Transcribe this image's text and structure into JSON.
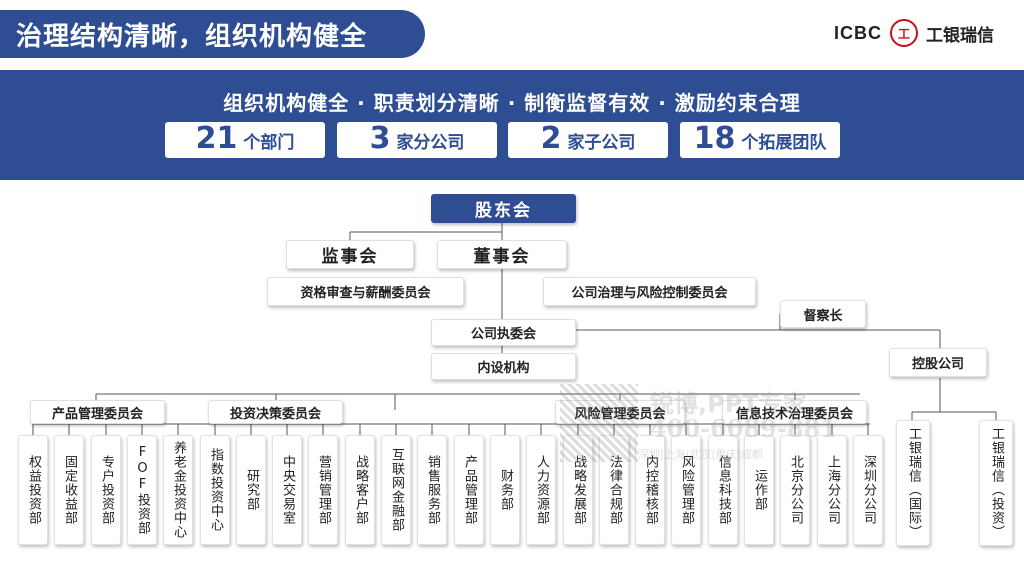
{
  "header": {
    "title": "治理结构清晰，组织机构健全",
    "logo_en": "ICBC",
    "logo_mark": "工",
    "logo_cn": "工银瑞信"
  },
  "banner": {
    "slogan": "组织机构健全 · 职责划分清晰 · 制衡监督有效 · 激励约束合理",
    "stats": [
      {
        "number": "21",
        "unit": "个部门"
      },
      {
        "number": "3",
        "unit": "家分公司"
      },
      {
        "number": "2",
        "unit": "家子公司"
      },
      {
        "number": "18",
        "unit": "个拓展团队"
      }
    ]
  },
  "org": {
    "shareholders": "股东会",
    "supervisors": "监事会",
    "board": "董事会",
    "committee_left": "资格审查与薪酬委员会",
    "committee_right": "公司治理与风险控制委员会",
    "inspector": "督察长",
    "executive": "公司执委会",
    "internal": "内设机构",
    "holding": "控股公司",
    "groups": [
      "产品管理委员会",
      "投资决策委员会",
      "风险管理委员会",
      "信息技术治理委员会"
    ],
    "departments": [
      "权益投资部",
      "固定收益部",
      "专户投资部",
      "FOF投资部",
      "养老金投资中心",
      "指数投资中心",
      "研究部",
      "中央交易室",
      "营销管理部",
      "战略客户部",
      "互联网金融部",
      "销售服务部",
      "产品管理部",
      "财务部",
      "人力资源部",
      "战略发展部",
      "法律合规部",
      "内控稽核部",
      "风险管理部",
      "信息科技部",
      "运作部",
      "北京分公司",
      "上海分公司",
      "深圳分公司"
    ],
    "subsidiaries": [
      "工银瑞信（国际）",
      "工银瑞信（投资）"
    ]
  },
  "watermark": {
    "brand": "锐博,PPT专家",
    "phone": "400-6089-881",
    "cities": "深圳|上海|武汉|重庆|成都"
  }
}
